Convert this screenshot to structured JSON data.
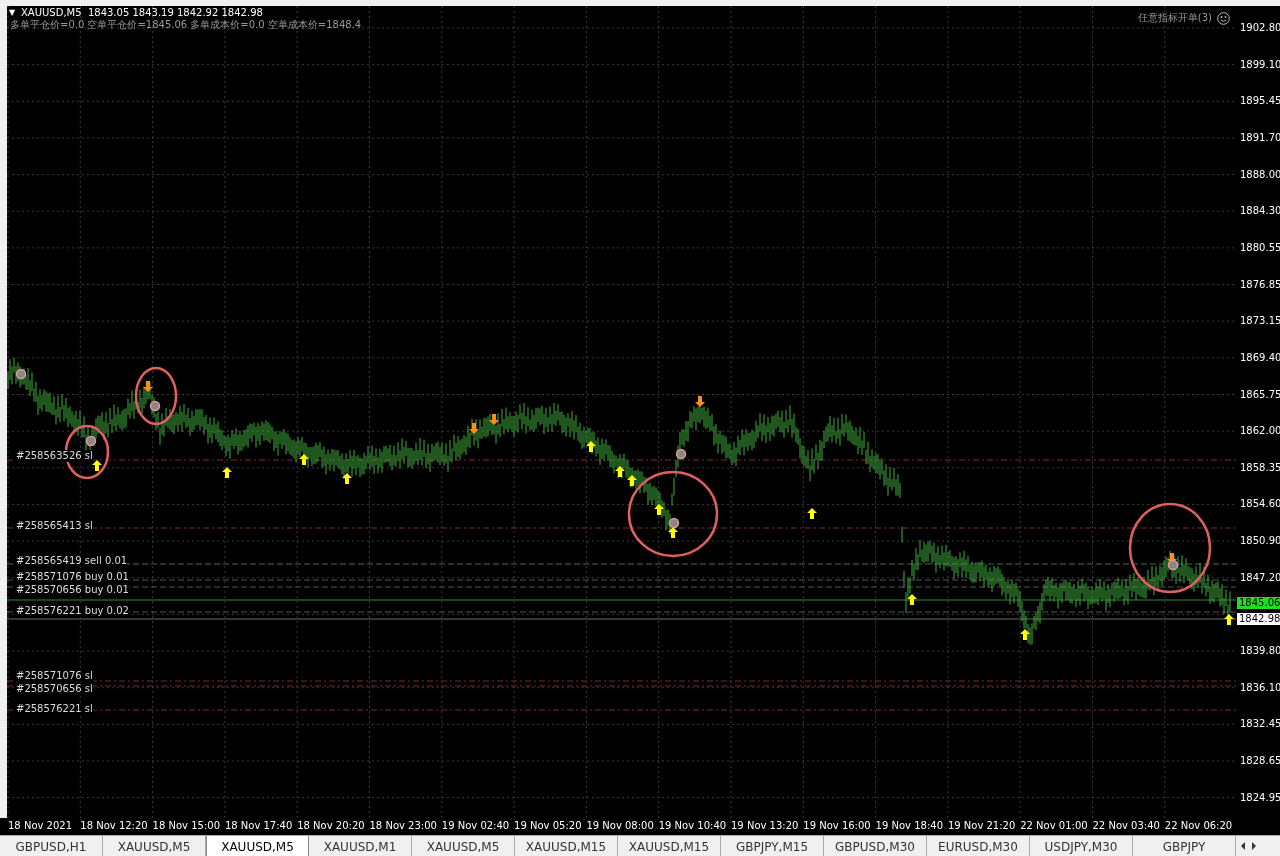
{
  "chart": {
    "collapse_glyph": "▼",
    "symbol_line": "XAUUSD,M5  1843.05 1843.19 1842.92 1842.98",
    "stats_line": "多单平仓价=0.0 空单平仓价=1845.06 多单成本价=0.0 空单成本价=1848.4",
    "indicator_label": "任意指标开单(3)",
    "order_labels": [
      {
        "text": "#258563526 sl"
      },
      {
        "text": "#258565413 sl"
      },
      {
        "text": "#258565419 sell 0.01"
      },
      {
        "text": "#258571076 buy 0.01"
      },
      {
        "text": "#258570656 buy 0.01"
      },
      {
        "text": "#258576221 buy 0.02"
      },
      {
        "text": "#258571076 sl"
      },
      {
        "text": "#258570656 sl"
      },
      {
        "text": "#258576221 sl"
      }
    ],
    "price_axis": [
      "1902.80",
      "1899.10",
      "1895.45",
      "1891.70",
      "1888.00",
      "1884.30",
      "1880.55",
      "1876.85",
      "1873.15",
      "1869.40",
      "1865.75",
      "1862.00",
      "1858.35",
      "1854.60",
      "1850.90",
      "1847.20",
      "1839.80",
      "1836.10",
      "1832.45",
      "1828.65",
      "1824.95"
    ],
    "bid_tag": "1845.06",
    "ask_tag": "1842.98",
    "time_axis": [
      "18 Nov 2021",
      "18 Nov 12:20",
      "18 Nov 15:00",
      "18 Nov 17:40",
      "18 Nov 20:20",
      "18 Nov 23:00",
      "19 Nov 02:40",
      "19 Nov 05:20",
      "19 Nov 08:00",
      "19 Nov 10:40",
      "19 Nov 13:20",
      "19 Nov 16:00",
      "19 Nov 18:40",
      "19 Nov 21:20",
      "22 Nov 01:00",
      "22 Nov 03:40",
      "22 Nov 06:20"
    ]
  },
  "tabs": [
    {
      "label": "GBPUSD,H1",
      "selected": false
    },
    {
      "label": "XAUUSD,M5",
      "selected": false
    },
    {
      "label": "XAUUSD,M5",
      "selected": true
    },
    {
      "label": "XAUUSD,M1",
      "selected": false
    },
    {
      "label": "XAUUSD,M5",
      "selected": false
    },
    {
      "label": "XAUUSD,M15",
      "selected": false
    },
    {
      "label": "XAUUSD,M15",
      "selected": false
    },
    {
      "label": "GBPJPY,M15",
      "selected": false
    },
    {
      "label": "GBPUSD,M30",
      "selected": false
    },
    {
      "label": "EURUSD,M30",
      "selected": false
    },
    {
      "label": "USDJPY,M30",
      "selected": false
    },
    {
      "label": "GBPJPY",
      "selected": false
    }
  ]
}
